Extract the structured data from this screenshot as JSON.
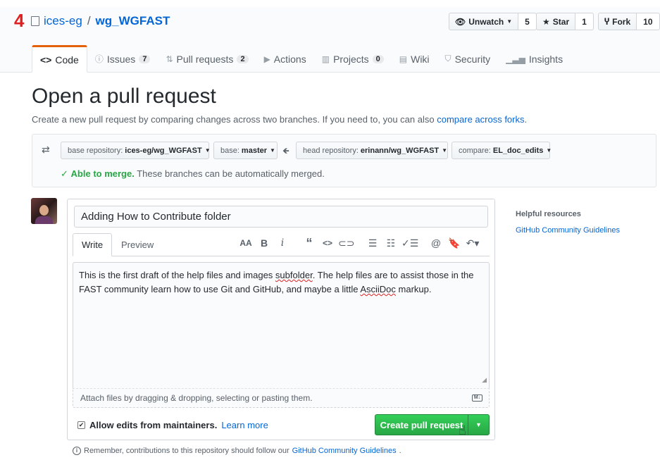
{
  "step_marker": "4",
  "repo": {
    "owner": "ices-eg",
    "separator": "/",
    "name": "wg_WGFAST"
  },
  "social": {
    "watch": {
      "label": "Unwatch",
      "count": "5"
    },
    "star": {
      "label": "Star",
      "count": "1"
    },
    "fork": {
      "label": "Fork",
      "count": "10"
    }
  },
  "tabs": [
    {
      "label": "Code",
      "icon": "code-icon",
      "counter": ""
    },
    {
      "label": "Issues",
      "icon": "issue-icon",
      "counter": "7"
    },
    {
      "label": "Pull requests",
      "icon": "pull-request-icon",
      "counter": "2"
    },
    {
      "label": "Actions",
      "icon": "play-icon",
      "counter": ""
    },
    {
      "label": "Projects",
      "icon": "project-icon",
      "counter": "0"
    },
    {
      "label": "Wiki",
      "icon": "book-icon",
      "counter": ""
    },
    {
      "label": "Security",
      "icon": "shield-icon",
      "counter": ""
    },
    {
      "label": "Insights",
      "icon": "graph-icon",
      "counter": ""
    }
  ],
  "page": {
    "title": "Open a pull request",
    "description": "Create a new pull request by comparing changes across two branches. If you need to, you can also",
    "description_link": "compare across forks",
    "description_end": "."
  },
  "compare": {
    "base_repo_label": "base repository:",
    "base_repo_value": "ices-eg/wg_WGFAST",
    "base_label": "base:",
    "base_value": "master",
    "head_repo_label": "head repository:",
    "head_repo_value": "erinann/wg_WGFAST",
    "compare_label": "compare:",
    "compare_value": "EL_doc_edits",
    "merge_status": "Able to merge.",
    "merge_detail": "These branches can be automatically merged."
  },
  "form": {
    "title_value": "Adding How to Contribute folder",
    "tab_write": "Write",
    "tab_preview": "Preview",
    "toolbar": [
      "AA",
      "B",
      "i",
      "quote-icon",
      "code-icon",
      "link-icon",
      "bulleted-list-icon",
      "numbered-list-icon",
      "task-list-icon",
      "mention-icon",
      "bookmark-icon",
      "reply-icon"
    ],
    "body_part1": "This is the first draft of the help files and images ",
    "body_misspelled1": "subfolder",
    "body_part2": ". The help files are to assist those in the FAST community learn how to use Git and GitHub, and maybe a little ",
    "body_misspelled2": "AsciiDoc",
    "body_part3": " markup.",
    "attach_text": "Attach files by dragging & dropping, selecting or pasting them.",
    "markdown_badge": "M↓",
    "allow_edits": "Allow edits from maintainers.",
    "learn_more": "Learn more",
    "submit_label": "Create pull request"
  },
  "footer": {
    "text": "Remember, contributions to this repository should follow our",
    "link": "GitHub Community Guidelines",
    "end": "."
  },
  "sidebar": {
    "title": "Helpful resources",
    "link": "GitHub Community Guidelines"
  }
}
